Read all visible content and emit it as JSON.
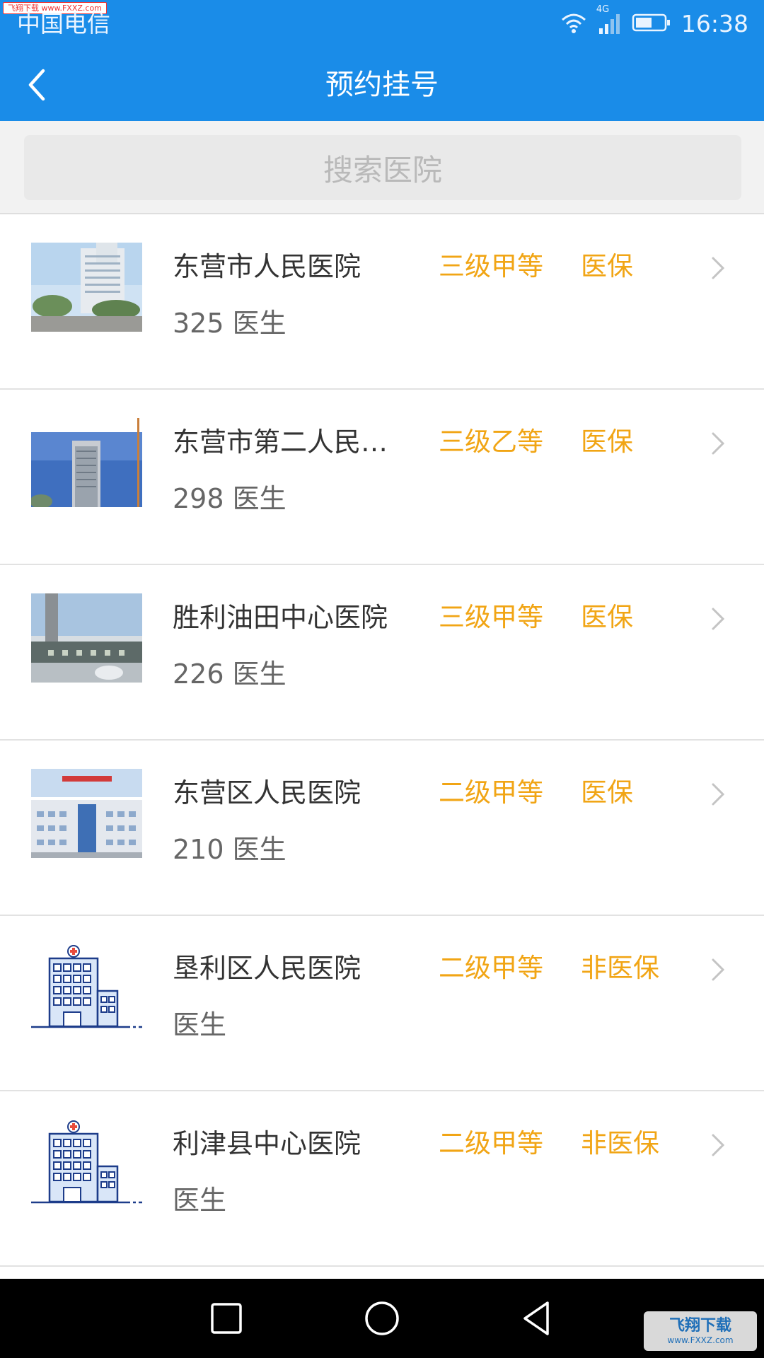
{
  "status_bar": {
    "watermark": "飞翔下载 www.FXXZ.com",
    "carrier": "中国电信",
    "network": "4G",
    "time": "16:38"
  },
  "header": {
    "title": "预约挂号"
  },
  "search": {
    "placeholder": "搜索医院"
  },
  "hospitals": [
    {
      "name": "东营市人民医院",
      "level": "三级甲等",
      "insurance": "医保",
      "doctors": "325 医生"
    },
    {
      "name": "东营市第二人民医院",
      "level": "三级乙等",
      "insurance": "医保",
      "doctors": "298 医生"
    },
    {
      "name": "胜利油田中心医院",
      "level": "三级甲等",
      "insurance": "医保",
      "doctors": "226 医生"
    },
    {
      "name": "东营区人民医院",
      "level": "二级甲等",
      "insurance": "医保",
      "doctors": "210 医生"
    },
    {
      "name": "垦利区人民医院",
      "level": "二级甲等",
      "insurance": "非医保",
      "doctors": "医生"
    },
    {
      "name": "利津县中心医院",
      "level": "二级甲等",
      "insurance": "非医保",
      "doctors": "医生"
    }
  ],
  "footer": {
    "logo_text": "飞翔下载",
    "logo_url": "www.FXXZ.com"
  },
  "colors": {
    "primary": "#1a8ce8",
    "accent": "#f1a515",
    "text": "#333333",
    "subtext": "#666666"
  },
  "icons": {
    "back": "chevron-left-icon",
    "row_arrow": "chevron-right-icon",
    "placeholder_thumb": "hospital-building-icon"
  }
}
